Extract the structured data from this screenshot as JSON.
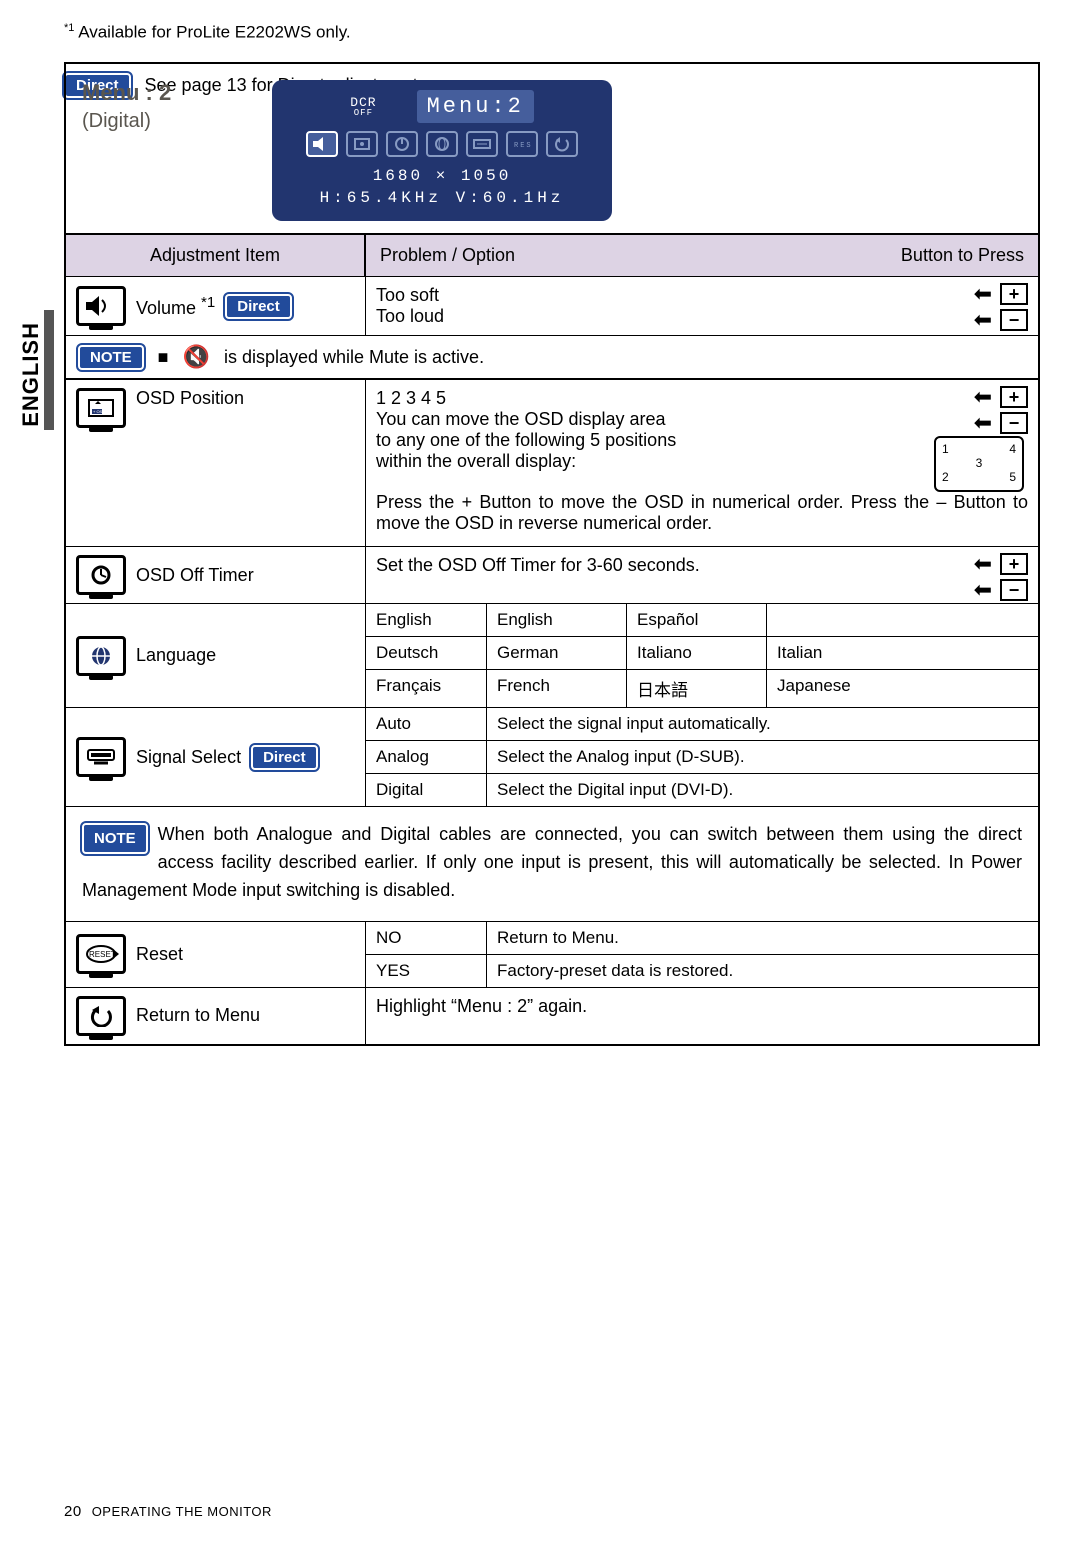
{
  "sidetab": "ENGLISH",
  "header": {
    "title": "Menu : 2",
    "subtitle": "(Digital)",
    "osd": {
      "dcr": "DCR",
      "dcr_sub": "OFF",
      "badge": "Menu:2",
      "resolution": "1680 × 1050",
      "freq": "H:65.4KHz  V:60.1Hz"
    }
  },
  "cols": {
    "a": "Adjustment Item",
    "b": "Problem / Option",
    "c": "Button to Press"
  },
  "volume": {
    "label": "Volume ",
    "sup": "*1",
    "direct": "Direct",
    "soft": "Too  soft",
    "loud": "Too loud"
  },
  "note_mute": {
    "badge": "NOTE",
    "bullet": "■",
    "text": " is displayed while Mute is active."
  },
  "osd_pos": {
    "label": "OSD Position",
    "nums": "1 2 3 4 5",
    "desc1": "You can move the OSD display area",
    "desc2": "to any one of the following 5 positions",
    "desc3": "within the overall display:",
    "diag": {
      "p1": "1",
      "p2": "2",
      "p3": "3",
      "p4": "4",
      "p5": "5"
    },
    "desc4": "Press the + Button to move the OSD in numerical order. Press the – Button to move the OSD in reverse numerical order."
  },
  "osd_off": {
    "label": "OSD Off Timer",
    "text": "Set the OSD Off Timer for 3-60 seconds."
  },
  "language": {
    "label": "Language",
    "r1": [
      "English",
      "English",
      "Español",
      ""
    ],
    "r2": [
      "Deutsch",
      "German",
      "Italiano",
      "Italian"
    ],
    "r3": [
      "Français",
      "French",
      "日本語",
      "Japanese"
    ]
  },
  "signal": {
    "label": "Signal Select",
    "direct": "Direct",
    "rows": [
      [
        "Auto",
        "Select the signal input automatically."
      ],
      [
        "Analog",
        "Select the Analog input (D-SUB)."
      ],
      [
        "Digital",
        "Select the Digital input (DVI-D)."
      ]
    ]
  },
  "note_signal": {
    "badge": "NOTE",
    "text": "When both Analogue and Digital cables are connected, you can switch between them using the direct access facility described earlier.  If only one input is present, this will automatically be selected.  In Power Management Mode input switching is disabled."
  },
  "reset": {
    "label": "Reset",
    "rows": [
      [
        "NO",
        "Return to Menu."
      ],
      [
        "YES",
        "Factory-preset data is restored."
      ]
    ]
  },
  "return": {
    "label": "Return to Menu",
    "text": "Highlight “Menu : 2” again."
  },
  "footnote": {
    "sup": "*1",
    "text": "  Available for ProLite E2202WS only."
  },
  "direct_footer": {
    "badge": "Direct",
    "text": "See page 13 for Direct adjustment."
  },
  "pagefoot": {
    "num": "20",
    "text": "OPERATING THE MONITOR"
  }
}
